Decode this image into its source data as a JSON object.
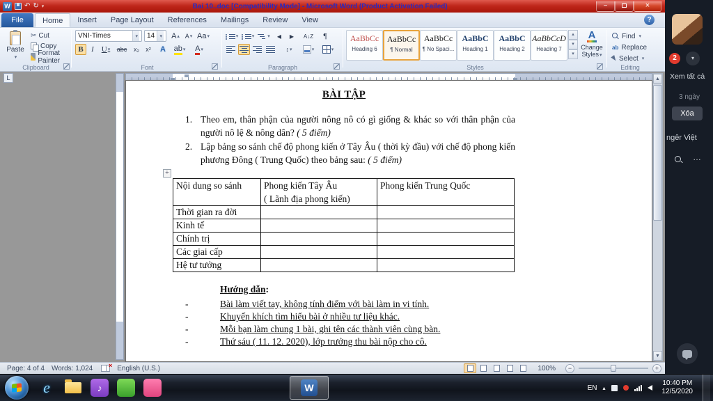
{
  "icons": {
    "app_letter": "W",
    "undo": "↶",
    "repeat": "↻",
    "caret_down": "▾",
    "caret_up": "▴",
    "minimize": "−",
    "close": "×",
    "help": "?",
    "cut": "✂",
    "bold": "B",
    "italic": "I",
    "underline": "U",
    "strike": "abc",
    "subscript": "x₂",
    "superscript": "x²",
    "letter_A": "A",
    "letter_Aa": "Aa",
    "letter_ab": "ab",
    "pilcrow": "¶",
    "sort": "A↓Z",
    "line_spacing": "↕",
    "arrow_up": "▲",
    "arrow_down": "▼",
    "indent_left": "◀",
    "indent_right": "▶",
    "tab_stop": "L",
    "table_handle": "+",
    "ie_letter": "e",
    "note": "♪",
    "plus": "+",
    "minus": "−",
    "ellipsis": "…"
  },
  "titlebar": {
    "title": "Bai 10..doc [Compatibility Mode] - Microsoft Word (Product Activation Failed)"
  },
  "ribbon": {
    "file": "File",
    "tabs": [
      "Home",
      "Insert",
      "Page Layout",
      "References",
      "Mailings",
      "Review",
      "View"
    ],
    "clipboard": {
      "label": "Clipboard",
      "paste": "Paste",
      "cut": "Cut",
      "copy": "Copy",
      "format_painter": "Format Painter"
    },
    "font": {
      "label": "Font",
      "name": "VNI-Times",
      "size": "14"
    },
    "paragraph": {
      "label": "Paragraph"
    },
    "styles": {
      "label": "Styles",
      "change_line1": "Change",
      "change_line2": "Styles",
      "items": [
        {
          "preview": "AaBbCc",
          "name": "Heading 6"
        },
        {
          "preview": "AaBbCc",
          "name": "¶ Normal"
        },
        {
          "preview": "AaBbCc",
          "name": "¶ No Spaci..."
        },
        {
          "preview": "AaBbC",
          "name": "Heading 1"
        },
        {
          "preview": "AaBbC",
          "name": "Heading 2"
        },
        {
          "preview": "AaBbCcD",
          "name": "Heading 7"
        }
      ]
    },
    "editing": {
      "label": "Editing",
      "find": "Find",
      "replace": "Replace",
      "select": "Select"
    }
  },
  "document": {
    "title": "BÀI TẬP",
    "list": [
      {
        "number": "1.",
        "text": "Theo em, thân phận của người nông nô có gì giống & khác so với thân phận của người nô lệ & nông dân?",
        "suffix": " ( 5 điểm)"
      },
      {
        "number": "2.",
        "text": "Lập bảng so sánh chế độ phong kiến ở Tây Âu ( thời kỳ đầu) với chế độ phong kiến phương Đông ( Trung Quốc) theo bảng sau:",
        "suffix": " ( 5 điểm)"
      }
    ],
    "table": {
      "col1_header": "Nội dung so sánh",
      "col2_header_line1": "Phong kiến Tây Âu",
      "col2_header_line2": "( Lãnh địa phong kiến)",
      "col3_header": "Phong kiến Trung Quốc",
      "rows": [
        "Thời gian ra đời",
        "Kinh tế",
        "Chính trị",
        "Các giai cấp",
        "Hệ tư tưởng"
      ]
    },
    "guide": {
      "title": "Hướng dẫn",
      "colon": ":",
      "marker": "-",
      "items": [
        "Bài làm viết tay, không tính điểm với bài làm in vi tính.",
        "Khuyến khích tìm hiểu bài ở nhiều tư liệu khác.",
        "Mỗi bạn làm chung 1 bài, ghi tên các thành viên cùng bàn.",
        "Thứ sáu ( 11. 12. 2020), lớp trưởng thu bài nộp cho cô."
      ]
    }
  },
  "statusbar": {
    "page": "Page: 4 of 4",
    "words": "Words: 1,024",
    "language": "English (U.S.)",
    "zoom": "100%"
  },
  "taskbar": {
    "language": "EN",
    "time": "10:40 PM",
    "date": "12/5/2020"
  },
  "side_panel": {
    "badge": "2",
    "view_all": "Xem tất cả",
    "time_ago": "3 ngày",
    "delete_button": "Xóa",
    "language_item": "ngêr Việt"
  }
}
